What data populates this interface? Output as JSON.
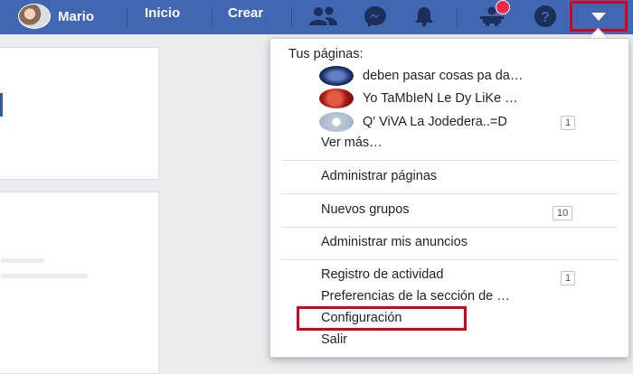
{
  "topbar": {
    "user_name": "Mario",
    "home_label": "Inicio",
    "create_label": "Crear",
    "icons": [
      "friends-icon",
      "messenger-icon",
      "bell-icon",
      "quick-help-icon",
      "help-icon",
      "caret-down-icon"
    ],
    "bar_color": "#4267b2"
  },
  "menu": {
    "pages_header": "Tus páginas:",
    "pages": [
      {
        "name": "deben pasar cosas pa da…"
      },
      {
        "name": "Yo TaMbIeN Le Dy LiKe …"
      },
      {
        "name": "Q' ViVA La Jodedera..=D",
        "badge": "1"
      }
    ],
    "see_more": "Ver más…",
    "manage_pages": "Administrar páginas",
    "new_groups": "Nuevos grupos",
    "new_groups_badge": "10",
    "manage_ads": "Administrar mis anuncios",
    "activity_log": "Registro de actividad",
    "activity_log_badge": "1",
    "news_feed_prefs": "Preferencias de la sección de …",
    "settings": "Configuración",
    "logout": "Salir"
  },
  "highlight_color": "#d0021b"
}
